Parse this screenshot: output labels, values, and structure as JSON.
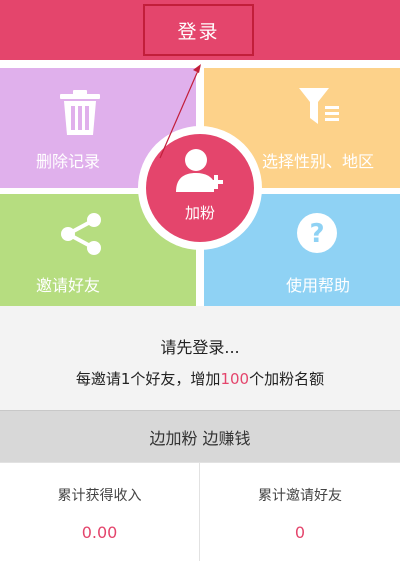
{
  "header": {
    "login_label": "登录"
  },
  "tiles": {
    "delete_records": "删除记录",
    "filter": "选择性别、地区",
    "invite_friends": "邀请好友",
    "help": "使用帮助"
  },
  "center": {
    "label": "加粉"
  },
  "info": {
    "line1": "请先登录...",
    "line2_prefix": "每邀请1个好友，增加",
    "line2_highlight": "100",
    "line2_suffix": "个加粉名额"
  },
  "slogan": "边加粉 边赚钱",
  "stats": {
    "income_label": "累计获得收入",
    "income_value": "0.00",
    "invited_label": "累计邀请好友",
    "invited_value": "0"
  },
  "colors": {
    "brand": "#e4456c",
    "tile_delete": "#e0b0ec",
    "tile_filter": "#fdd28a",
    "tile_invite": "#b6dd80",
    "tile_help": "#8fd2f4"
  },
  "icons": {
    "delete": "trash-icon",
    "filter": "filter-icon",
    "invite": "share-icon",
    "help": "question-icon",
    "center": "add-user-icon"
  }
}
